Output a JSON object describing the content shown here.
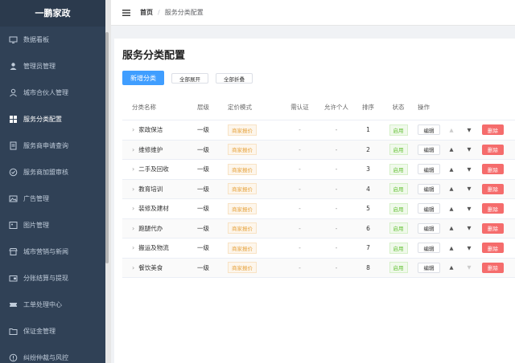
{
  "sidebar": {
    "brand": "一鹏家政",
    "items": [
      {
        "label": "数据看板",
        "icon": "monitor-icon"
      },
      {
        "label": "管理员管理",
        "icon": "user-icon"
      },
      {
        "label": "城市合伙人管理",
        "icon": "user-outline-icon"
      },
      {
        "label": "服务分类配置",
        "icon": "grid-icon"
      },
      {
        "label": "服务商申请查询",
        "icon": "document-icon"
      },
      {
        "label": "服务商加盟审核",
        "icon": "check-circle-icon"
      },
      {
        "label": "广告管理",
        "icon": "image-icon"
      },
      {
        "label": "图片管理",
        "icon": "picture-icon"
      },
      {
        "label": "城市营销与新闻",
        "icon": "shop-icon"
      },
      {
        "label": "分账结算与提现",
        "icon": "wallet-icon"
      },
      {
        "label": "工单处理中心",
        "icon": "ticket-icon"
      },
      {
        "label": "保证金管理",
        "icon": "folder-icon"
      },
      {
        "label": "纠纷仲裁与风控",
        "icon": "info-icon"
      }
    ]
  },
  "header": {
    "home": "首页",
    "separator": "/",
    "current": "服务分类配置"
  },
  "page": {
    "title": "服务分类配置",
    "add_button": "新增分类",
    "expand_all": "全部展开",
    "collapse_all": "全部折叠"
  },
  "table": {
    "headers": {
      "name": "分类名称",
      "level": "层级",
      "mode": "定价模式",
      "auth": "需认证",
      "personal": "允许个人",
      "order": "排序",
      "status": "状态",
      "ops": "操作"
    },
    "edit_label": "编辑",
    "delete_label": "删除",
    "up_arrow": "▲",
    "down_arrow": "▼",
    "rows": [
      {
        "name": "家政保洁",
        "level": "一级",
        "mode": "商家报价",
        "auth": "-",
        "personal": "-",
        "order": "1",
        "status": "启用"
      },
      {
        "name": "维修维护",
        "level": "一级",
        "mode": "商家报价",
        "auth": "-",
        "personal": "-",
        "order": "2",
        "status": "启用"
      },
      {
        "name": "二手及回收",
        "level": "一级",
        "mode": "商家报价",
        "auth": "-",
        "personal": "-",
        "order": "3",
        "status": "启用"
      },
      {
        "name": "教育培训",
        "level": "一级",
        "mode": "商家报价",
        "auth": "-",
        "personal": "-",
        "order": "4",
        "status": "启用"
      },
      {
        "name": "装修及建材",
        "level": "一级",
        "mode": "商家报价",
        "auth": "-",
        "personal": "-",
        "order": "5",
        "status": "启用"
      },
      {
        "name": "跑腿代办",
        "level": "一级",
        "mode": "商家报价",
        "auth": "-",
        "personal": "-",
        "order": "6",
        "status": "启用"
      },
      {
        "name": "搬运及物流",
        "level": "一级",
        "mode": "商家报价",
        "auth": "-",
        "personal": "-",
        "order": "7",
        "status": "启用"
      },
      {
        "name": "餐饮美食",
        "level": "一级",
        "mode": "商家报价",
        "auth": "-",
        "personal": "-",
        "order": "8",
        "status": "启用"
      }
    ]
  },
  "colors": {
    "sidebar_bg": "#304156",
    "primary": "#409eff",
    "danger": "#f56c6c",
    "success": "#67c23a",
    "warning": "#e6a23c"
  }
}
